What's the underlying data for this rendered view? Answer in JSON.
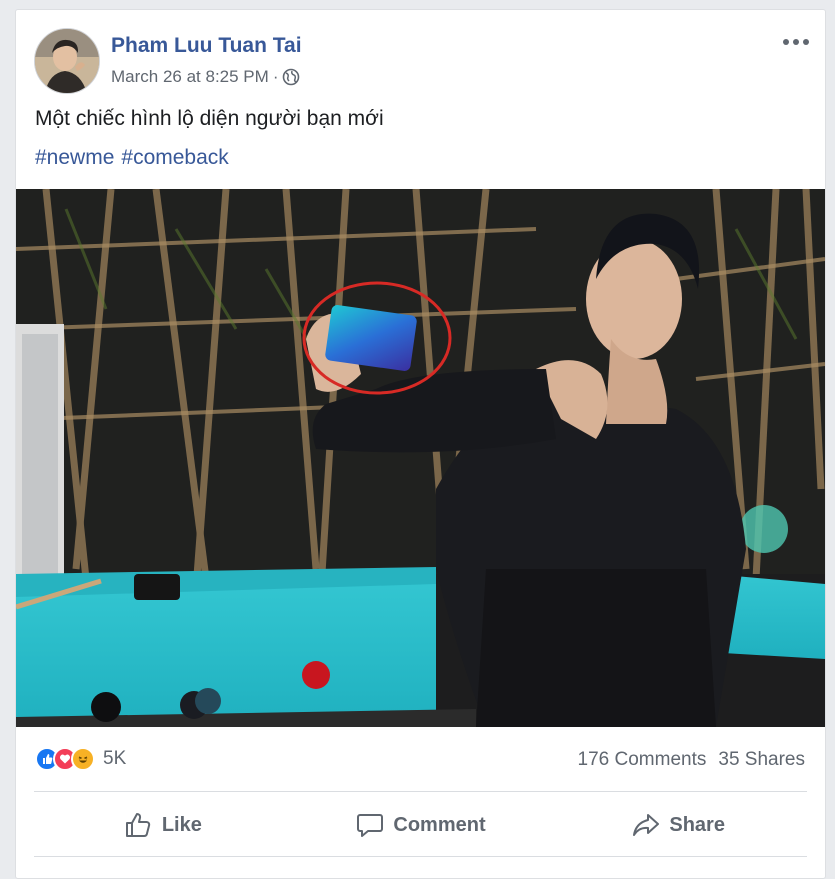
{
  "post": {
    "author": "Pham Luu Tuan Tai",
    "timestamp": "March 26 at 8:25 PM",
    "separator": "·",
    "audience_icon": "globe-icon",
    "caption": "Một chiếc hình lộ diện người bạn mới",
    "hashtags": [
      "#newme",
      "#comeback"
    ]
  },
  "reactions": {
    "icons": [
      "like-reaction-icon",
      "love-reaction-icon",
      "haha-reaction-icon"
    ],
    "count": "5K"
  },
  "stats": {
    "comments": "176 Comments",
    "shares": "35 Shares"
  },
  "actions": {
    "like": "Like",
    "comment": "Comment",
    "share": "Share"
  },
  "colors": {
    "link": "#385898",
    "secondary_text": "#606770",
    "like_blue": "#1877f2",
    "love_red": "#f33e58",
    "haha_yellow": "#f7b125",
    "pool_table": "#2ec3cf"
  }
}
